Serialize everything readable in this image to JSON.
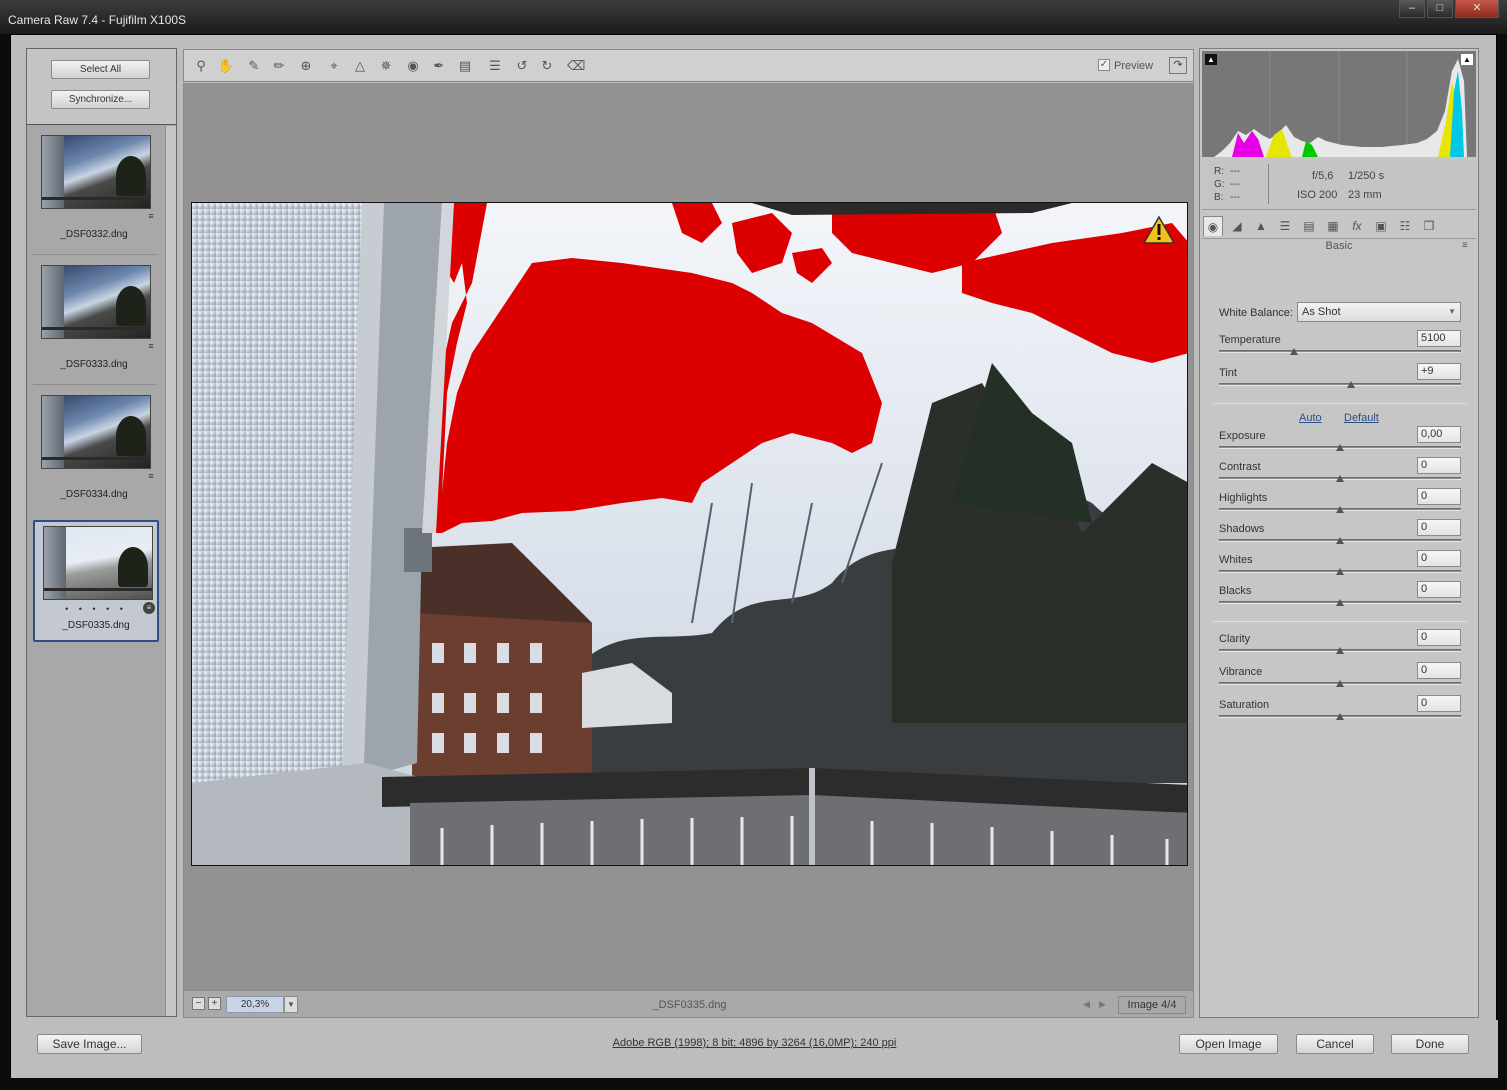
{
  "window": {
    "title": "Camera Raw 7.4  -  Fujifilm X100S",
    "controls": [
      "–",
      "□",
      "✕"
    ]
  },
  "filmstrip": {
    "select_all_label": "Select All",
    "synchronize_label": "Synchronize...",
    "items": [
      {
        "filename": "_DSF0332.dng",
        "selected": false
      },
      {
        "filename": "_DSF0333.dng",
        "selected": false
      },
      {
        "filename": "_DSF0334.dng",
        "selected": false
      },
      {
        "filename": "_DSF0335.dng",
        "selected": true,
        "rating_dots": "• • • • •"
      }
    ]
  },
  "toolbar": {
    "tools": [
      "zoom-tool-icon",
      "hand-tool-icon",
      "white-balance-tool-icon",
      "color-sampler-tool-icon",
      "targeted-adjustment-tool-icon",
      "crop-tool-icon",
      "straighten-tool-icon",
      "spot-removal-tool-icon",
      "red-eye-tool-icon",
      "adjustment-brush-icon",
      "graduated-filter-icon",
      "preferences-icon",
      "rotate-left-icon",
      "rotate-right-icon",
      "trash-icon"
    ],
    "preview_label": "Preview",
    "preview_checked": true
  },
  "preview": {
    "clipping_warning_color": "#dd0000",
    "warning_icon": "warning-triangle-icon"
  },
  "status": {
    "zoom_out": "−",
    "zoom_in": "+",
    "zoom_value": "20,3%",
    "filename": "_DSF0335.dng",
    "image_counter": "Image 4/4"
  },
  "info": {
    "r_label": "R:",
    "g_label": "G:",
    "b_label": "B:",
    "r_value": "---",
    "g_value": "---",
    "b_value": "---",
    "aperture": "f/5,6",
    "shutter": "1/250 s",
    "iso": "ISO 200",
    "focal_length": "23 mm"
  },
  "panel": {
    "title": "Basic",
    "tabs": [
      "basic-tab-icon",
      "tone-curve-tab-icon",
      "detail-tab-icon",
      "hsl-tab-icon",
      "split-toning-tab-icon",
      "lens-corrections-tab-icon",
      "effects-tab-icon",
      "camera-calibration-tab-icon",
      "presets-tab-icon",
      "snapshots-tab-icon"
    ],
    "white_balance_label": "White Balance:",
    "white_balance_value": "As Shot",
    "auto_label": "Auto",
    "default_label": "Default",
    "sliders_wb": [
      {
        "label": "Temperature",
        "value": "5100",
        "position": 0.31
      },
      {
        "label": "Tint",
        "value": "+9",
        "position": 0.545
      }
    ],
    "sliders_tone": [
      {
        "label": "Exposure",
        "value": "0,00",
        "position": 0.5
      },
      {
        "label": "Contrast",
        "value": "0",
        "position": 0.5
      },
      {
        "label": "Highlights",
        "value": "0",
        "position": 0.5
      },
      {
        "label": "Shadows",
        "value": "0",
        "position": 0.5
      },
      {
        "label": "Whites",
        "value": "0",
        "position": 0.5
      },
      {
        "label": "Blacks",
        "value": "0",
        "position": 0.5
      }
    ],
    "sliders_presence": [
      {
        "label": "Clarity",
        "value": "0",
        "position": 0.5
      },
      {
        "label": "Vibrance",
        "value": "0",
        "position": 0.5
      },
      {
        "label": "Saturation",
        "value": "0",
        "position": 0.5
      }
    ]
  },
  "bottom": {
    "save_label": "Save Image...",
    "workflow_options": "Adobe RGB (1998); 8 bit; 4896 by 3264 (16,0MP); 240 ppi",
    "open_label": "Open Image",
    "cancel_label": "Cancel",
    "done_label": "Done"
  }
}
